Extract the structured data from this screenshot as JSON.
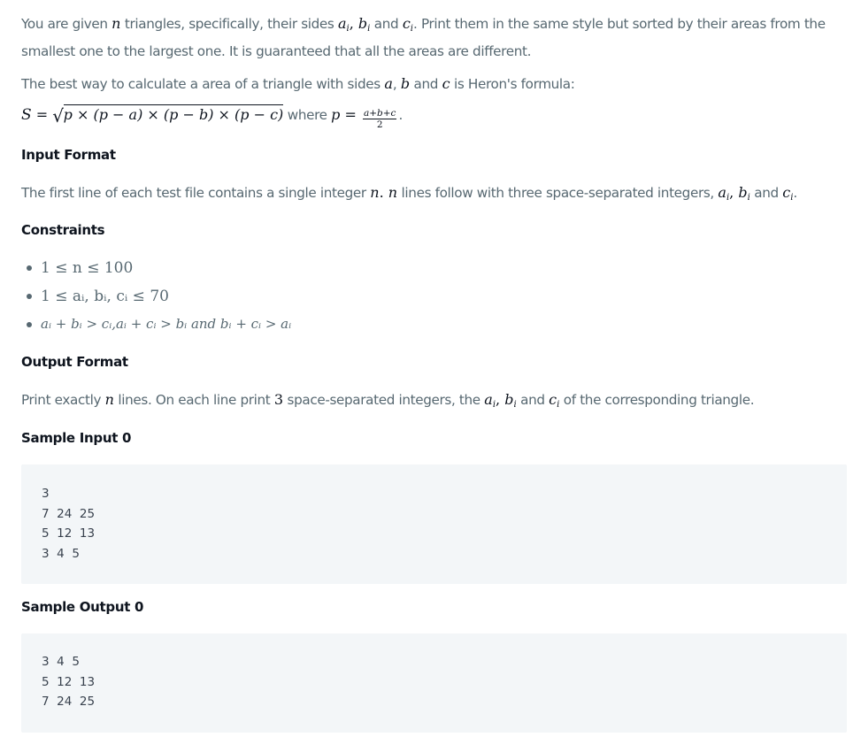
{
  "intro": {
    "line1_a": "You are given ",
    "n": "n",
    "line1_b": " triangles, specifically, their sides ",
    "a_i": "a",
    "b_i": "b",
    "c_i": "c",
    "sub_i": "i",
    "comma": ", ",
    "and": " and ",
    "line1_c": ". Print them in the same style but sorted by their areas from the",
    "line2": "smallest one to the largest one. It is guaranteed that all the areas are different.",
    "line3_a": "The best way to calculate a area of a triangle with sides ",
    "a": "a",
    "comma2": ", ",
    "b": "b",
    "and2": " and ",
    "c": "c",
    "line3_b": " is Heron's formula:"
  },
  "formula": {
    "lhs": "S",
    "eq": " = ",
    "radical": "√",
    "radicand": "p × (p − a) × (p − b) × (p − c)",
    "where": " where ",
    "p": "p",
    "eq2": " = ",
    "numerator": "a+b+c",
    "denominator": "2",
    "period": "."
  },
  "input_format": {
    "heading": "Input Format",
    "text_a": "The first line of each test file contains a single integer ",
    "n": "n",
    "dot": ". ",
    "n2": "n",
    "text_b": " lines follow with three space-separated integers, ",
    "end": "."
  },
  "constraints": {
    "heading": "Constraints",
    "items": [
      "1 ≤ n ≤ 100",
      "1 ≤ aᵢ, bᵢ, cᵢ ≤ 70",
      "aᵢ + bᵢ > cᵢ,aᵢ + cᵢ > bᵢ and bᵢ + cᵢ > aᵢ"
    ]
  },
  "output_format": {
    "heading": "Output Format",
    "text_a": "Print exactly ",
    "n": "n",
    "text_b": " lines. On each line print ",
    "three": "3",
    "text_c": " space-separated integers, the ",
    "text_d": " of the corresponding triangle."
  },
  "sample_input": {
    "heading": "Sample Input 0",
    "lines": [
      "3",
      "7  24  25",
      "5  12  13",
      "3  4  5"
    ]
  },
  "sample_output": {
    "heading": "Sample Output 0",
    "lines": [
      "3  4  5",
      "5  12  13",
      "7  24  25"
    ]
  }
}
